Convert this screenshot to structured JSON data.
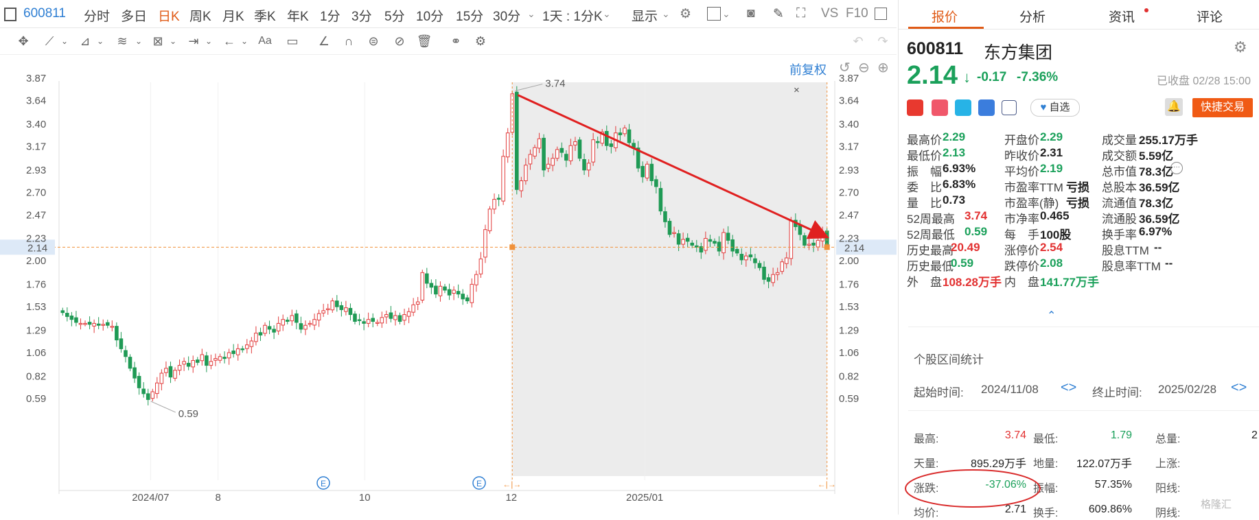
{
  "toolbar": {
    "code": "600811",
    "periods": [
      "分时",
      "多日",
      "日K",
      "周K",
      "月K",
      "季K",
      "年K",
      "1分",
      "3分",
      "5分",
      "10分",
      "15分",
      "30分"
    ],
    "active_period": "日K",
    "range_select": "1天 : 1分K",
    "display": "显示",
    "vs": "VS",
    "f10": "F10"
  },
  "chart": {
    "fuquan": "前复权",
    "yticks": [
      "3.87",
      "3.64",
      "3.40",
      "3.17",
      "2.93",
      "2.70",
      "2.47",
      "2.23",
      "2.00",
      "1.76",
      "1.53",
      "1.29",
      "1.06",
      "0.82",
      "0.59"
    ],
    "ytick_values": [
      3.87,
      3.64,
      3.4,
      3.17,
      2.93,
      2.7,
      2.47,
      2.23,
      2.0,
      1.76,
      1.53,
      1.29,
      1.06,
      0.82,
      0.59
    ],
    "xticks": [
      "2024/07",
      "8",
      "10",
      "12",
      "2025/01"
    ],
    "current_price": "2.14",
    "high_label": "3.74",
    "low_label": "0.59",
    "event_marker": "E",
    "close_symbol": "×"
  },
  "chart_data": {
    "type": "candlestick",
    "title": "",
    "xlabel": "",
    "ylabel": "",
    "ylim": [
      0.5,
      3.95
    ],
    "closes": [
      1.47,
      1.43,
      1.4,
      1.37,
      1.36,
      1.36,
      1.35,
      1.36,
      1.34,
      1.35,
      1.34,
      1.33,
      1.19,
      1.1,
      1.02,
      0.9,
      0.8,
      0.7,
      0.64,
      0.58,
      0.66,
      0.75,
      0.85,
      0.9,
      0.81,
      0.88,
      0.93,
      0.97,
      0.92,
      0.98,
      0.96,
      1.04,
      0.93,
      0.97,
      1.0,
      1.02,
      1.0,
      1.06,
      1.05,
      1.1,
      1.09,
      1.14,
      1.18,
      1.26,
      1.24,
      1.34,
      1.3,
      1.27,
      1.36,
      1.4,
      1.38,
      1.44,
      1.37,
      1.3,
      1.34,
      1.36,
      1.4,
      1.46,
      1.49,
      1.51,
      1.59,
      1.53,
      1.5,
      1.52,
      1.45,
      1.38,
      1.39,
      1.36,
      1.4,
      1.38,
      1.37,
      1.42,
      1.45,
      1.41,
      1.44,
      1.38,
      1.45,
      1.48,
      1.55,
      1.58,
      1.88,
      1.77,
      1.73,
      1.66,
      1.74,
      1.7,
      1.65,
      1.7,
      1.66,
      1.61,
      1.59,
      1.76,
      1.86,
      2.02,
      2.32,
      2.53,
      2.63,
      2.63,
      3.07,
      3.31,
      3.71,
      2.73,
      2.82,
      2.98,
      3.09,
      3.16,
      3.25,
      2.93,
      2.99,
      3.05,
      3.14,
      3.11,
      3.03,
      3.18,
      3.22,
      3.05,
      2.93,
      3.0,
      3.24,
      3.21,
      3.32,
      3.18,
      3.17,
      3.31,
      3.29,
      3.36,
      3.21,
      3.15,
      2.95,
      2.86,
      2.99,
      2.82,
      2.76,
      2.51,
      2.4,
      2.27,
      2.29,
      2.17,
      2.22,
      2.2,
      2.16,
      2.14,
      2.09,
      2.23,
      2.2,
      2.18,
      2.1,
      2.29,
      2.21,
      2.1,
      2.08,
      2.01,
      2.05,
      2.04,
      1.98,
      1.93,
      1.81,
      1.79,
      1.86,
      1.88,
      1.99,
      2.03,
      2.41,
      2.35,
      2.27,
      2.16,
      2.17,
      2.16,
      2.21,
      2.3,
      2.14
    ],
    "high": 3.74,
    "low": 0.59,
    "last": 2.14,
    "annotation": "3.74 -> 2.14 downtrend arrow"
  },
  "panel": {
    "tabs": [
      "报价",
      "分析",
      "资讯",
      "评论"
    ],
    "active_tab": "报价",
    "code": "600811",
    "name": "东方集团",
    "price": "2.14",
    "arrow": "↓",
    "change": "-0.17",
    "change_pct": "-7.36%",
    "closed_time": "已收盘 02/28 15:00",
    "zixuan": "自选",
    "trade": "快捷交易",
    "quote": [
      {
        "label": "最高价",
        "value": "2.29",
        "cls": "green"
      },
      {
        "label": "开盘价",
        "value": "2.29",
        "cls": "green"
      },
      {
        "label": "成交量",
        "value": "255.17万手",
        "cls": "dark"
      },
      {
        "label": "最低价",
        "value": "2.13",
        "cls": "green"
      },
      {
        "label": "昨收价",
        "value": "2.31",
        "cls": "dark"
      },
      {
        "label": "成交额",
        "value": "5.59亿",
        "cls": "dark"
      },
      {
        "label": "振　幅",
        "value": "6.93%",
        "cls": "dark"
      },
      {
        "label": "平均价",
        "value": "2.19",
        "cls": "green"
      },
      {
        "label": "总市值",
        "value": "78.3亿",
        "cls": "dark"
      },
      {
        "label": "委　比",
        "value": "6.83%",
        "cls": "dark"
      },
      {
        "label": "市盈率TTM",
        "value": "亏损",
        "cls": "dark"
      },
      {
        "label": "总股本",
        "value": "36.59亿",
        "cls": "dark"
      },
      {
        "label": "量　比",
        "value": "0.73",
        "cls": "dark"
      },
      {
        "label": "市盈率(静)",
        "value": "亏损",
        "cls": "dark"
      },
      {
        "label": "流通值",
        "value": "78.3亿",
        "cls": "dark"
      },
      {
        "label": "52周最高",
        "value": "3.74",
        "cls": "red"
      },
      {
        "label": "市净率",
        "value": "0.465",
        "cls": "dark"
      },
      {
        "label": "流通股",
        "value": "36.59亿",
        "cls": "dark"
      },
      {
        "label": "52周最低",
        "value": "0.59",
        "cls": "green"
      },
      {
        "label": "每　手",
        "value": "100股",
        "cls": "dark"
      },
      {
        "label": "换手率",
        "value": "6.97%",
        "cls": "dark"
      },
      {
        "label": "历史最高",
        "value": "20.49",
        "cls": "red"
      },
      {
        "label": "涨停价",
        "value": "2.54",
        "cls": "red"
      },
      {
        "label": "股息TTM",
        "value": "--",
        "cls": "dark"
      },
      {
        "label": "历史最低",
        "value": "0.59",
        "cls": "green"
      },
      {
        "label": "跌停价",
        "value": "2.08",
        "cls": "green"
      },
      {
        "label": "股息率TTM",
        "value": "--",
        "cls": "dark"
      },
      {
        "label": "外　盘",
        "value": "108.28万手",
        "cls": "red"
      },
      {
        "label": "内　盘",
        "value": "141.77万手",
        "cls": "green"
      }
    ],
    "interval": {
      "title": "个股区间统计",
      "start_label": "起始时间:",
      "start": "2024/11/08",
      "end_label": "终止时间:",
      "end": "2025/02/28",
      "rows": [
        [
          {
            "l": "最高:",
            "v": "3.74",
            "c": "red"
          },
          {
            "l": "最低:",
            "v": "1.79",
            "c": "green"
          },
          {
            "l": "总量:",
            "v": "2",
            "c": "dark"
          }
        ],
        [
          {
            "l": "天量:",
            "v": "895.29万手",
            "c": "dark"
          },
          {
            "l": "地量:",
            "v": "122.07万手",
            "c": "dark"
          },
          {
            "l": "上涨:",
            "v": "",
            "c": "dark"
          }
        ],
        [
          {
            "l": "涨跌:",
            "v": "-37.06%",
            "c": "green"
          },
          {
            "l": "振幅:",
            "v": "57.35%",
            "c": "dark"
          },
          {
            "l": "阳线:",
            "v": "",
            "c": "dark"
          }
        ],
        [
          {
            "l": "均价:",
            "v": "2.71",
            "c": "dark"
          },
          {
            "l": "换手:",
            "v": "609.86%",
            "c": "dark"
          },
          {
            "l": "阴线:",
            "v": "",
            "c": "dark"
          }
        ]
      ]
    },
    "watermark": "格隆汇"
  }
}
